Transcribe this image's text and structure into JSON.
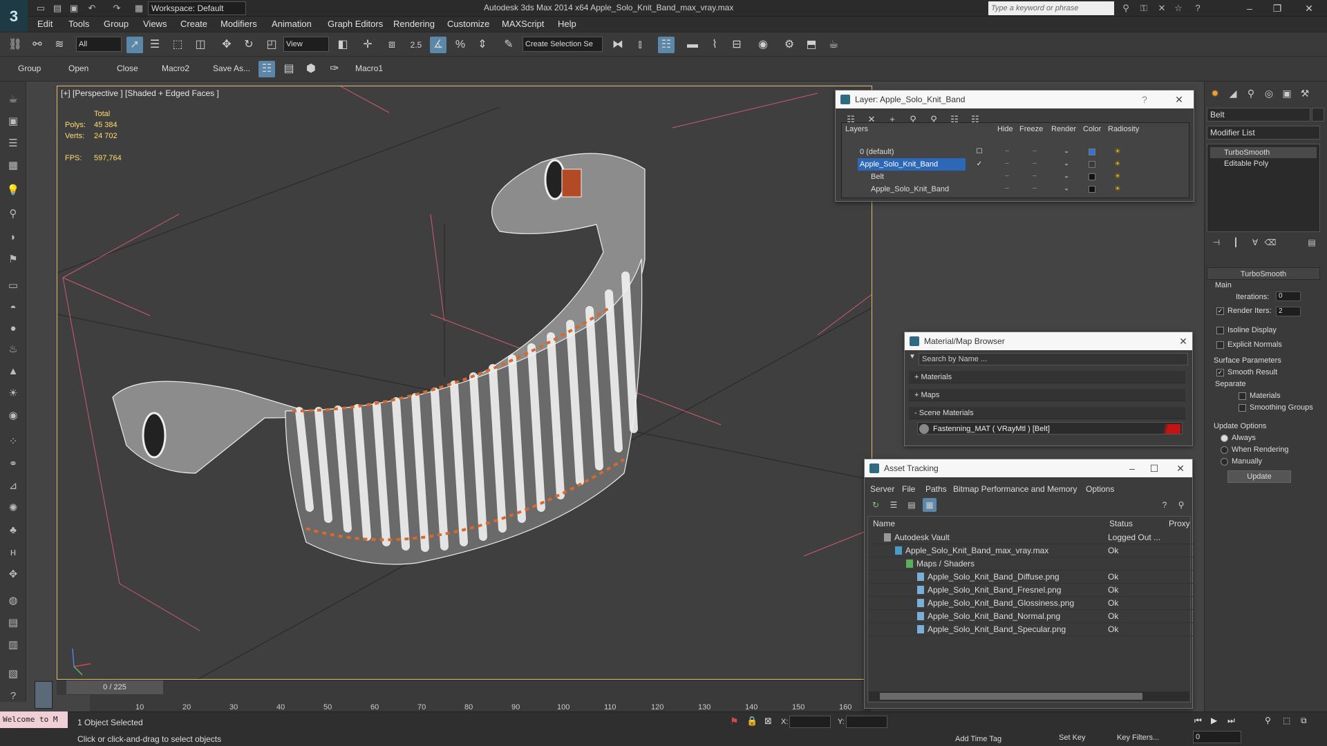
{
  "app": {
    "title": "Autodesk 3ds Max  2014 x64     Apple_Solo_Knit_Band_max_vray.max",
    "logo_text": "3",
    "workspace": "Workspace: Default",
    "search_placeholder": "Type a keyword or phrase"
  },
  "menu": [
    "Edit",
    "Tools",
    "Group",
    "Views",
    "Create",
    "Modifiers",
    "Animation",
    "Graph Editors",
    "Rendering",
    "Customize",
    "MAXScript",
    "Help"
  ],
  "main_toolbar": {
    "selection_filter": "All",
    "reference_coord": "View",
    "snap_value": "2.5",
    "named_selection": "Create Selection Se"
  },
  "sub_toolbar": [
    "Group",
    "Open",
    "Close",
    "Macro2",
    "Save As...",
    "Macro1"
  ],
  "viewport": {
    "label": "[+] [Perspective ] [Shaded + Edged Faces ]",
    "stats": {
      "total_label": "Total",
      "polys_label": "Polys:",
      "polys_value": "45 384",
      "verts_label": "Verts:",
      "verts_value": "24 702",
      "fps_label": "FPS:",
      "fps_value": "597,764"
    }
  },
  "timeline": {
    "frame": "0 / 225",
    "ticks": [
      "10",
      "20",
      "30",
      "40",
      "50",
      "60",
      "70",
      "80",
      "90",
      "100",
      "110",
      "120",
      "130",
      "140",
      "150",
      "160"
    ]
  },
  "status": {
    "welcome": "Welcome to M",
    "selection": "1 Object Selected",
    "prompt": "Click or click-and-drag to select objects",
    "x_label": "X:",
    "y_label": "Y:",
    "add_time_tag": "Add Time Tag",
    "set_key": "Set Key",
    "key_filters": "Key Filters...",
    "frame_field": "0"
  },
  "layer_window": {
    "title": "Layer: Apple_Solo_Knit_Band",
    "columns": [
      "Layers",
      "Hide",
      "Freeze",
      "Render",
      "Color",
      "Radiosity"
    ],
    "rows": [
      {
        "name": "0 (default)",
        "color": "#3b6fd6"
      },
      {
        "name": "Apple_Solo_Knit_Band",
        "color": "#3a3a3a"
      },
      {
        "name": "Belt",
        "color": "#111111"
      },
      {
        "name": "Apple_Solo_Knit_Band",
        "color": "#111111"
      }
    ]
  },
  "material_browser": {
    "title": "Material/Map Browser",
    "search_placeholder": "Search by Name ...",
    "sections": [
      "+ Materials",
      "+ Maps",
      "- Scene Materials"
    ],
    "scene_material": "Fastenning_MAT  ( VRayMtl )  [Belt]"
  },
  "asset_tracking": {
    "title": "Asset Tracking",
    "menu": [
      "Server",
      "File",
      "Paths",
      "Bitmap Performance and Memory",
      "Options"
    ],
    "columns": [
      "Name",
      "Status",
      "Proxy"
    ],
    "rows": [
      {
        "name": "Autodesk Vault",
        "status": "Logged Out ..."
      },
      {
        "name": "Apple_Solo_Knit_Band_max_vray.max",
        "status": "Ok"
      },
      {
        "name": "Maps / Shaders",
        "status": ""
      },
      {
        "name": "Apple_Solo_Knit_Band_Diffuse.png",
        "status": "Ok"
      },
      {
        "name": "Apple_Solo_Knit_Band_Fresnel.png",
        "status": "Ok"
      },
      {
        "name": "Apple_Solo_Knit_Band_Glossiness.png",
        "status": "Ok"
      },
      {
        "name": "Apple_Solo_Knit_Band_Normal.png",
        "status": "Ok"
      },
      {
        "name": "Apple_Solo_Knit_Band_Specular.png",
        "status": "Ok"
      }
    ]
  },
  "command_panel": {
    "object_name": "Belt",
    "modifier_list": "Modifier List",
    "stack": [
      "TurboSmooth",
      "Editable Poly"
    ],
    "turbosmooth": {
      "rollout": "TurboSmooth",
      "main": "Main",
      "iterations_label": "Iterations:",
      "iterations_value": "0",
      "render_iters_label": "Render Iters:",
      "render_iters_value": "2",
      "isoline": "Isoline Display",
      "explicit_normals": "Explicit Normals",
      "surface_params": "Surface Parameters",
      "smooth_result": "Smooth Result",
      "separate": "Separate",
      "materials": "Materials",
      "smoothing_groups": "Smoothing Groups",
      "update_options": "Update Options",
      "always": "Always",
      "when_rendering": "When Rendering",
      "manually": "Manually",
      "update_button": "Update"
    }
  }
}
